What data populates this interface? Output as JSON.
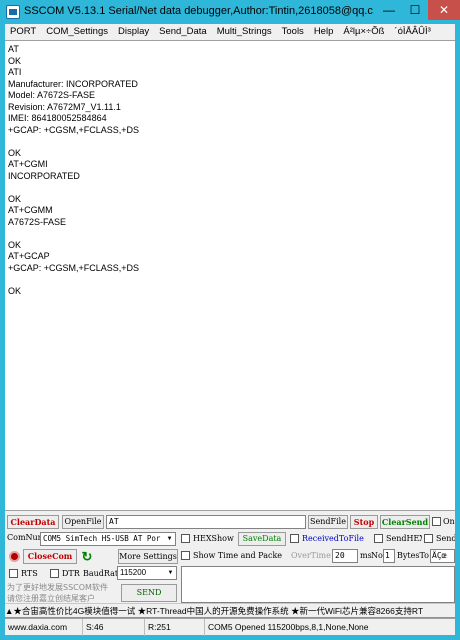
{
  "window": {
    "title": "SSCOM V5.13.1 Serial/Net data debugger,Author:Tintin,2618058@qq.c...",
    "minimize": "—",
    "maximize": "☐",
    "close": "✕"
  },
  "menu": [
    "PORT",
    "COM_Settings",
    "Display",
    "Send_Data",
    "Multi_Strings",
    "Tools",
    "Help",
    "Á²lµ×÷Õß",
    "´óÌÅÂÛÌ³"
  ],
  "terminal_lines": [
    "AT",
    "OK",
    "ATI",
    "Manufacturer: INCORPORATED",
    "Model: A7672S-FASE",
    "Revision: A7672M7_V1.11.1",
    "IMEI: 864180052584864",
    "+GCAP: +CGSM,+FCLASS,+DS",
    "",
    "OK",
    "AT+CGMI",
    "INCORPORATED",
    "",
    "OK",
    "AT+CGMM",
    "A7672S-FASE",
    "",
    "OK",
    "AT+GCAP",
    "+GCAP: +CGSM,+FCLASS,+DS",
    "",
    "OK"
  ],
  "controls": {
    "clear_data": "ClearData",
    "open_file": "OpenFile",
    "file_path": "AT",
    "send_file": "SendFile",
    "stop": "Stop",
    "clear_send": "ClearSend",
    "on_top": "On",
    "com_num_label": "ComNum",
    "com_port": "COM5 SimTech HS-USB AT Por",
    "hex_show": "HEXShow",
    "save_data": "SaveData",
    "received_to_file": "ReceivedToFile",
    "send_hex": "SendHEX",
    "send_every": "SendE",
    "close_com": "CloseCom",
    "more_settings": "More Settings",
    "show_time": "Show Time and Packe",
    "overtime_label": "OverTime",
    "overtime_value": "20",
    "ms_label": "ms",
    "no_label": "No",
    "no_value": "1",
    "bytes_label": "BytesTo",
    "bytes_value": "ÄÇœ",
    "rts": "RTS",
    "dtr": "DTR",
    "baud_label": "BaudRat",
    "baud_value": "115200",
    "send": "SEND",
    "promo_line1": "为了更好地发展SSCOM软件",
    "promo_line2": "请您注册嘉立创结尾客户"
  },
  "ticker": "▲★合宙高性价比4G模块值得一试 ★RT-Thread中国人的开源免费操作系统 ★新一代WiFi芯片兼容8266支持RT",
  "status": {
    "website": "www.daxia.com",
    "s": "S:46",
    "r": "R:251",
    "port_state": "COM5 Opened  115200bps,8,1,None,None"
  },
  "colors": {
    "frame": "#2FB7DA",
    "close_button": "#C7504B",
    "clear_red": "#C00000",
    "save_green": "#008000"
  }
}
